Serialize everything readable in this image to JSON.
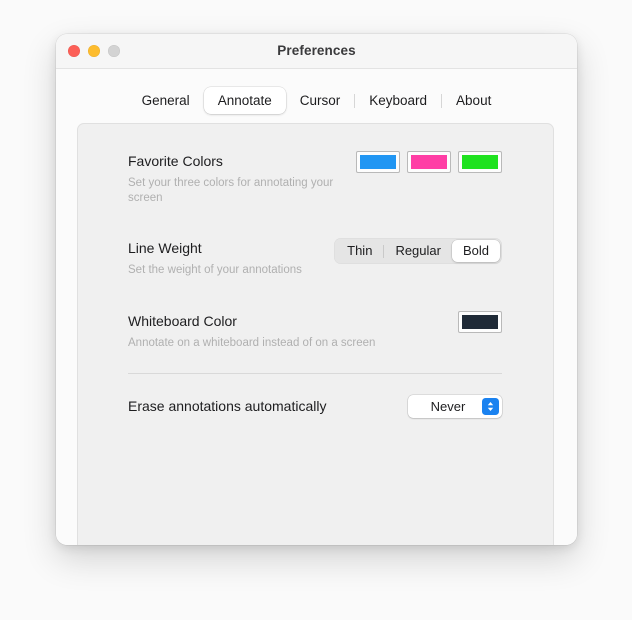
{
  "window": {
    "title": "Preferences",
    "traffic_lights": [
      {
        "name": "close",
        "color": "#fc5f57"
      },
      {
        "name": "minimize",
        "color": "#fdbc2e"
      },
      {
        "name": "zoom",
        "color": "#d3d3d3"
      }
    ]
  },
  "tabs": [
    {
      "label": "General",
      "selected": false
    },
    {
      "label": "Annotate",
      "selected": true
    },
    {
      "label": "Cursor",
      "selected": false
    },
    {
      "label": "Keyboard",
      "selected": false
    },
    {
      "label": "About",
      "selected": false
    }
  ],
  "settings": {
    "favorite_colors": {
      "title": "Favorite Colors",
      "subtitle": "Set your three colors for annotating your screen",
      "swatches": [
        {
          "name": "blue",
          "color": "#2196f3"
        },
        {
          "name": "pink",
          "color": "#ff3ea5"
        },
        {
          "name": "green",
          "color": "#1fe21f"
        }
      ]
    },
    "line_weight": {
      "title": "Line Weight",
      "subtitle": "Set the weight of your annotations",
      "options": [
        "Thin",
        "Regular",
        "Bold"
      ],
      "selected": "Bold"
    },
    "whiteboard_color": {
      "title": "Whiteboard Color",
      "subtitle": "Annotate on a whiteboard instead of on a screen",
      "swatch": {
        "name": "whiteboard",
        "color": "#1f2a37"
      }
    },
    "erase_automatically": {
      "title": "Erase annotations automatically",
      "value": "Never",
      "chevron_icon": "chevron-up-down-icon"
    }
  }
}
